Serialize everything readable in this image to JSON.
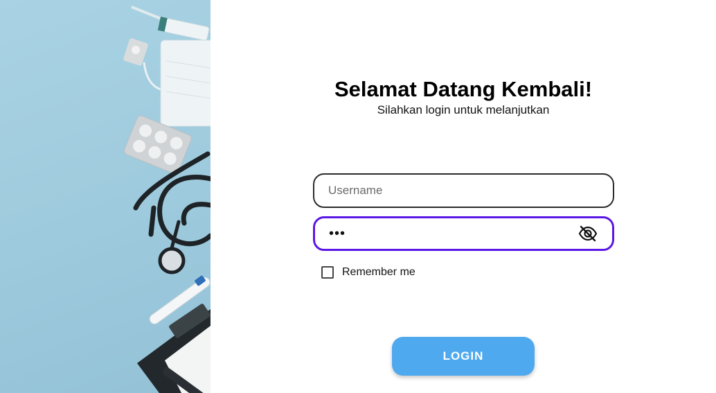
{
  "hero": {
    "image_description_icons": [
      "syringe-icon",
      "pill-icon",
      "face-mask-icon",
      "blister-pack-icon",
      "stethoscope-icon",
      "thermometer-icon",
      "clipboard-icon",
      "pen-icon"
    ]
  },
  "login": {
    "title": "Selamat Datang Kembali!",
    "subtitle": "Silahkan login untuk melanjutkan",
    "username_placeholder": "Username",
    "username_value": "",
    "password_value": "•••",
    "password_toggle_icon": "eye-off-icon",
    "remember_label": "Remember me",
    "remember_checked": false,
    "button_label": "LOGIN"
  },
  "colors": {
    "accent_focus": "#5a16e6",
    "button": "#4ea9ef",
    "hero_background": "#a9d3e4"
  }
}
